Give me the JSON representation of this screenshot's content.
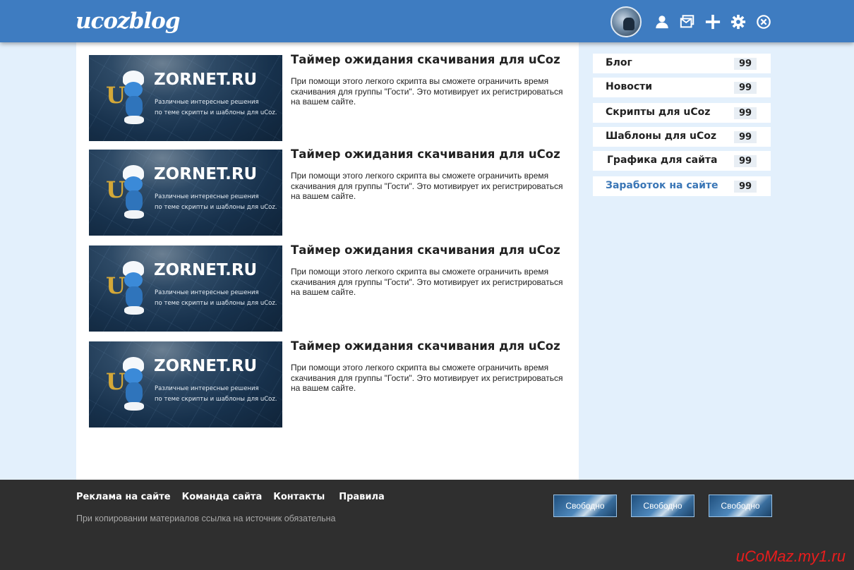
{
  "header": {
    "logo": "ucozblog",
    "icons": [
      "user-icon",
      "messages-icon",
      "add-icon",
      "settings-icon",
      "close-icon"
    ]
  },
  "posts": [
    {
      "thumb": {
        "initial": "U",
        "brand": "ZORNET.RU",
        "tag_line1": "Различные интересные решения",
        "tag_line2": "по теме скрипты и шаблоны для uCoz."
      },
      "title": "Таймер ожидания скачивания для uCoz",
      "desc": "При помощи этого легкого скрипта вы сможете ограничить время скачивания для группы \"Гости\". Это мотивирует их регистрироваться на вашем сайте."
    },
    {
      "thumb": {
        "initial": "U",
        "brand": "ZORNET.RU",
        "tag_line1": "Различные интересные решения",
        "tag_line2": "по теме скрипты и шаблоны для uCoz."
      },
      "title": "Таймер ожидания скачивания для uCoz",
      "desc": "При помощи этого легкого скрипта вы сможете ограничить время скачивания для группы \"Гости\". Это мотивирует их регистрироваться на вашем сайте."
    },
    {
      "thumb": {
        "initial": "U",
        "brand": "ZORNET.RU",
        "tag_line1": "Различные интересные решения",
        "tag_line2": "по теме скрипты и шаблоны для uCoz."
      },
      "title": "Таймер ожидания скачивания для uCoz",
      "desc": "При помощи этого легкого скрипта вы сможете ограничить время скачивания для группы \"Гости\". Это мотивирует их регистрироваться на вашем сайте."
    },
    {
      "thumb": {
        "initial": "U",
        "brand": "ZORNET.RU",
        "tag_line1": "Различные интересные решения",
        "tag_line2": "по теме скрипты и шаблоны для uCoz."
      },
      "title": "Таймер ожидания скачивания для uCoz",
      "desc": "При помощи этого легкого скрипта вы сможете ограничить время скачивания для группы \"Гости\". Это мотивирует их регистрироваться на вашем сайте."
    }
  ],
  "sidebar": {
    "items": [
      {
        "label": "Блог",
        "count": "99"
      },
      {
        "label": "Новости",
        "count": "99"
      },
      {
        "label": "Скрипты для uCoz",
        "count": "99"
      },
      {
        "label": "Шаблоны для uCoz",
        "count": "99"
      },
      {
        "label": "Графика для сайта",
        "count": "99"
      },
      {
        "label": "Заработок на сайте",
        "count": "99",
        "active": true
      }
    ],
    "active_color": "#3a76b6"
  },
  "footer": {
    "links": [
      "Реклама на сайте",
      "Команда сайта",
      "Контакты",
      "Правила"
    ],
    "copyright": "При копировании материалов ссылка на источник обязательна",
    "badges": [
      "Свободно",
      "Свободно",
      "Свободно"
    ],
    "watermark": "uCoMaz.my1.ru"
  },
  "colors": {
    "header_bg": "#3e7cc1",
    "page_bg": "#e3f0fc",
    "footer_bg": "#2f2f2f",
    "watermark": "#e81d1d"
  }
}
